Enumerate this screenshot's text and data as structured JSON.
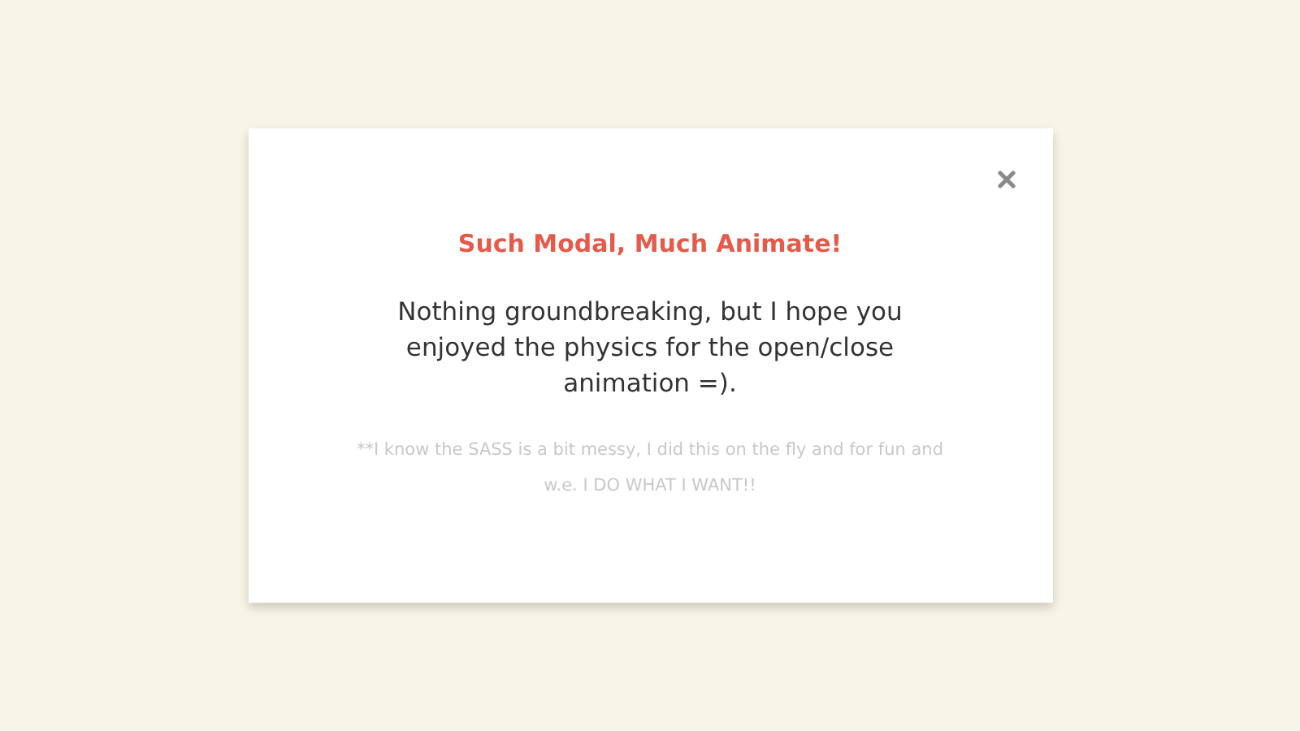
{
  "modal": {
    "title": "Such Modal, Much Animate!",
    "body": "Nothing groundbreaking, but I hope you enjoyed the physics for the open/close animation =).",
    "note": "**I know the SASS is a bit messy, I did this on the fly and for fun and w.e. I DO WHAT I WANT!!"
  }
}
